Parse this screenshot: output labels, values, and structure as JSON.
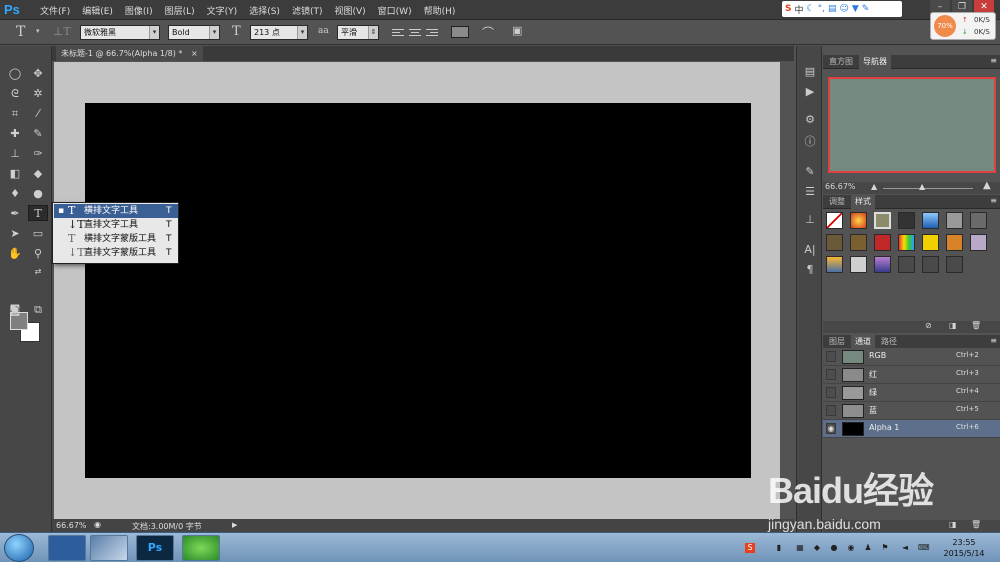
{
  "menubar": {
    "logo": "Ps",
    "items": [
      "文件(F)",
      "编辑(E)",
      "图像(I)",
      "图层(L)",
      "文字(Y)",
      "选择(S)",
      "滤镜(T)",
      "视图(V)",
      "窗口(W)",
      "帮助(H)"
    ]
  },
  "sogou": {
    "label": "中"
  },
  "speed_widget": {
    "percent": "70%",
    "up": "0K/S",
    "down": "0K/S"
  },
  "options": {
    "font_family": "微软雅黑",
    "font_style": "Bold",
    "font_size": "213 点",
    "antialias_icon": "aa",
    "antialias": "平滑"
  },
  "document": {
    "tab_label": "未标题-1 @ 66.7%(Alpha 1/8) *",
    "close": "×"
  },
  "status": {
    "zoom": "66.67%",
    "doc_info": "文档:3.00M/0 字节"
  },
  "flyout": {
    "items": [
      {
        "label": "横排文字工具",
        "key": "T",
        "selected": true
      },
      {
        "label": "直排文字工具",
        "key": "T",
        "selected": false
      },
      {
        "label": "横排文字蒙版工具",
        "key": "T",
        "selected": false
      },
      {
        "label": "直排文字蒙版工具",
        "key": "T",
        "selected": false
      }
    ]
  },
  "panel_top": {
    "tabs": [
      "直方图",
      "导航器"
    ],
    "active": "导航器",
    "zoom": "66.67%"
  },
  "panel_mid": {
    "tabs": [
      "调整",
      "样式"
    ],
    "active": "样式"
  },
  "panel_bottom": {
    "tabs": [
      "图层",
      "通道",
      "路径"
    ],
    "active": "通道",
    "channels": [
      {
        "name": "RGB",
        "key": "Ctrl+2",
        "thumb": "#75897f",
        "selected": false
      },
      {
        "name": "红",
        "key": "Ctrl+3",
        "thumb": "#8a8a8a",
        "selected": false
      },
      {
        "name": "绿",
        "key": "Ctrl+4",
        "thumb": "#999999",
        "selected": false
      },
      {
        "name": "蓝",
        "key": "Ctrl+5",
        "thumb": "#8e8e8e",
        "selected": false
      },
      {
        "name": "Alpha 1",
        "key": "Ctrl+6",
        "thumb": "#000000",
        "selected": true
      }
    ]
  },
  "taskbar": {
    "time": "23:55",
    "date": "2015/5/14"
  },
  "watermark": {
    "brand": "Baidu经验",
    "url": "jingyan.baidu.com"
  },
  "colors": {
    "canvas": "#000000",
    "selection": "#3a5f94",
    "nav_thumb": "#75897f"
  }
}
